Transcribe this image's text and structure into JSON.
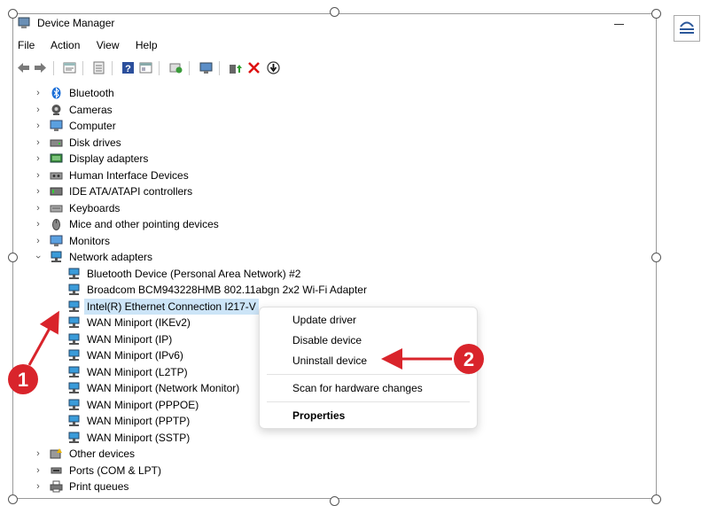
{
  "window": {
    "title": "Device Manager",
    "menu": [
      "File",
      "Action",
      "View",
      "Help"
    ]
  },
  "toolbar_icons": [
    "back-arrow-icon",
    "forward-arrow-icon",
    "properties-icon",
    "list-view-icon",
    "help-icon",
    "details-icon",
    "scan-hardware-icon",
    "monitor-icon",
    "update-driver-icon",
    "uninstall-icon",
    "disable-device-icon"
  ],
  "tree": {
    "categories_top": [
      {
        "label": "Bluetooth",
        "icon": "bluetooth-icon"
      },
      {
        "label": "Cameras",
        "icon": "camera-icon"
      },
      {
        "label": "Computer",
        "icon": "computer-icon"
      },
      {
        "label": "Disk drives",
        "icon": "disk-drive-icon"
      },
      {
        "label": "Display adapters",
        "icon": "display-adapter-icon"
      },
      {
        "label": "Human Interface Devices",
        "icon": "hid-icon"
      },
      {
        "label": "IDE ATA/ATAPI controllers",
        "icon": "ide-controller-icon"
      },
      {
        "label": "Keyboards",
        "icon": "keyboard-icon"
      },
      {
        "label": "Mice and other pointing devices",
        "icon": "mouse-icon"
      },
      {
        "label": "Monitors",
        "icon": "monitor-icon"
      }
    ],
    "network": {
      "label": "Network adapters",
      "children": [
        "Bluetooth Device (Personal Area Network) #2",
        "Broadcom BCM943228HMB 802.11abgn 2x2 Wi-Fi Adapter",
        "Intel(R) Ethernet Connection I217-V",
        "WAN Miniport (IKEv2)",
        "WAN Miniport (IP)",
        "WAN Miniport (IPv6)",
        "WAN Miniport (L2TP)",
        "WAN Miniport (Network Monitor)",
        "WAN Miniport (PPPOE)",
        "WAN Miniport (PPTP)",
        "WAN Miniport (SSTP)"
      ],
      "selected_index": 2
    },
    "categories_bottom": [
      {
        "label": "Other devices",
        "icon": "other-devices-icon"
      },
      {
        "label": "Ports (COM & LPT)",
        "icon": "ports-icon"
      },
      {
        "label": "Print queues",
        "icon": "printer-icon"
      }
    ]
  },
  "context_menu": {
    "update": "Update driver",
    "disable": "Disable device",
    "uninstall": "Uninstall device",
    "scan": "Scan for hardware changes",
    "properties": "Properties"
  },
  "annotations": {
    "step1": "1",
    "step2": "2",
    "color": "#d9242b"
  },
  "colors": {
    "selection": "#cce4f7",
    "network_icon": "#3a9bd9"
  }
}
